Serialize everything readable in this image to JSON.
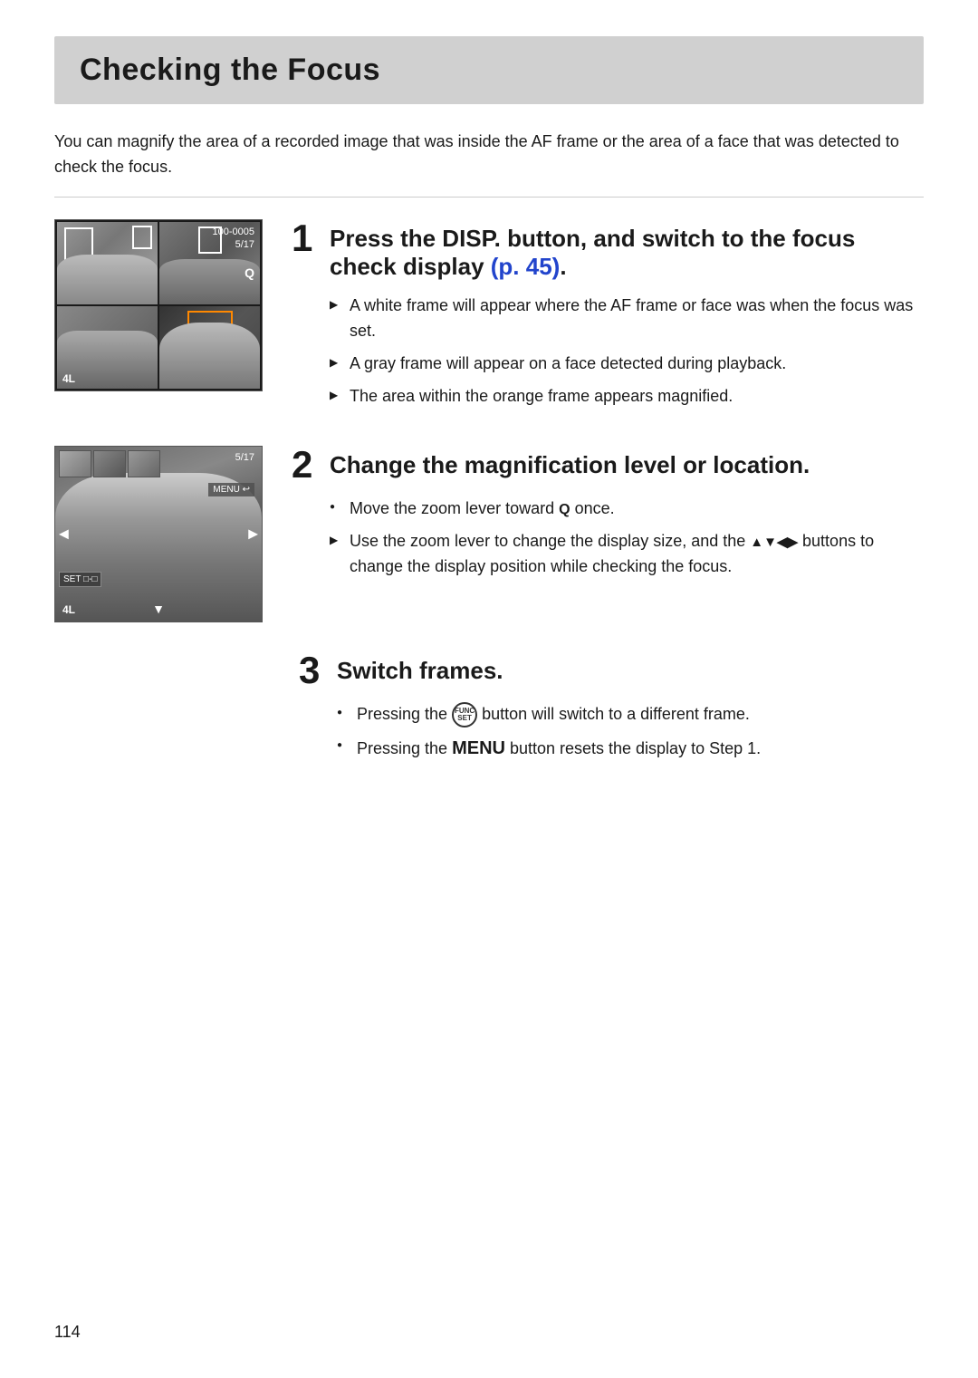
{
  "page": {
    "title": "Checking the Focus",
    "page_number": "114",
    "intro": "You can magnify the area of a recorded image that was inside the AF frame or the area of a face that was detected to check the focus."
  },
  "steps": [
    {
      "number": "1",
      "title_html": "Press the DISP. button, and switch to the focus check display (p. 45).",
      "title_plain": "Press the DISP. button, and switch to the focus check display (p. 45).",
      "bullets": [
        {
          "type": "arrow",
          "text": "A white frame will appear where the AF frame or face was when the focus was set."
        },
        {
          "type": "arrow",
          "text": "A gray frame will appear on a face detected during playback."
        },
        {
          "type": "arrow",
          "text": "The area within the orange frame appears magnified."
        }
      ],
      "image_info": {
        "top_right_line1": "100-0005",
        "top_right_line2": "5/17",
        "bottom_left": "4L"
      }
    },
    {
      "number": "2",
      "title": "Change the magnification level or location.",
      "bullets": [
        {
          "type": "circle",
          "text_parts": [
            "Move the zoom lever toward ",
            "Q",
            " once."
          ]
        },
        {
          "type": "arrow",
          "text": "Use the zoom lever to change the display size, and the ▲▼◀▶ buttons to change the display position while checking the focus."
        }
      ],
      "image_info": {
        "top_right": "5/17",
        "menu_label": "MENU ↩",
        "bottom_left": "4L",
        "set_label": "SET □-□"
      }
    },
    {
      "number": "3",
      "title": "Switch frames.",
      "bullets": [
        {
          "type": "circle",
          "text_parts": [
            "Pressing the ",
            "FUNC_SET",
            " button will switch to a different frame."
          ]
        },
        {
          "type": "circle",
          "text_parts": [
            "Pressing the ",
            "MENU",
            " button resets the display to Step 1."
          ]
        }
      ]
    }
  ],
  "labels": {
    "disp": "DISP.",
    "p45": "p. 45",
    "menu": "MENU",
    "func_set_label": "FUNC SET",
    "zoom_q": "Q",
    "nav_arrows": "▲▼◀▶"
  }
}
